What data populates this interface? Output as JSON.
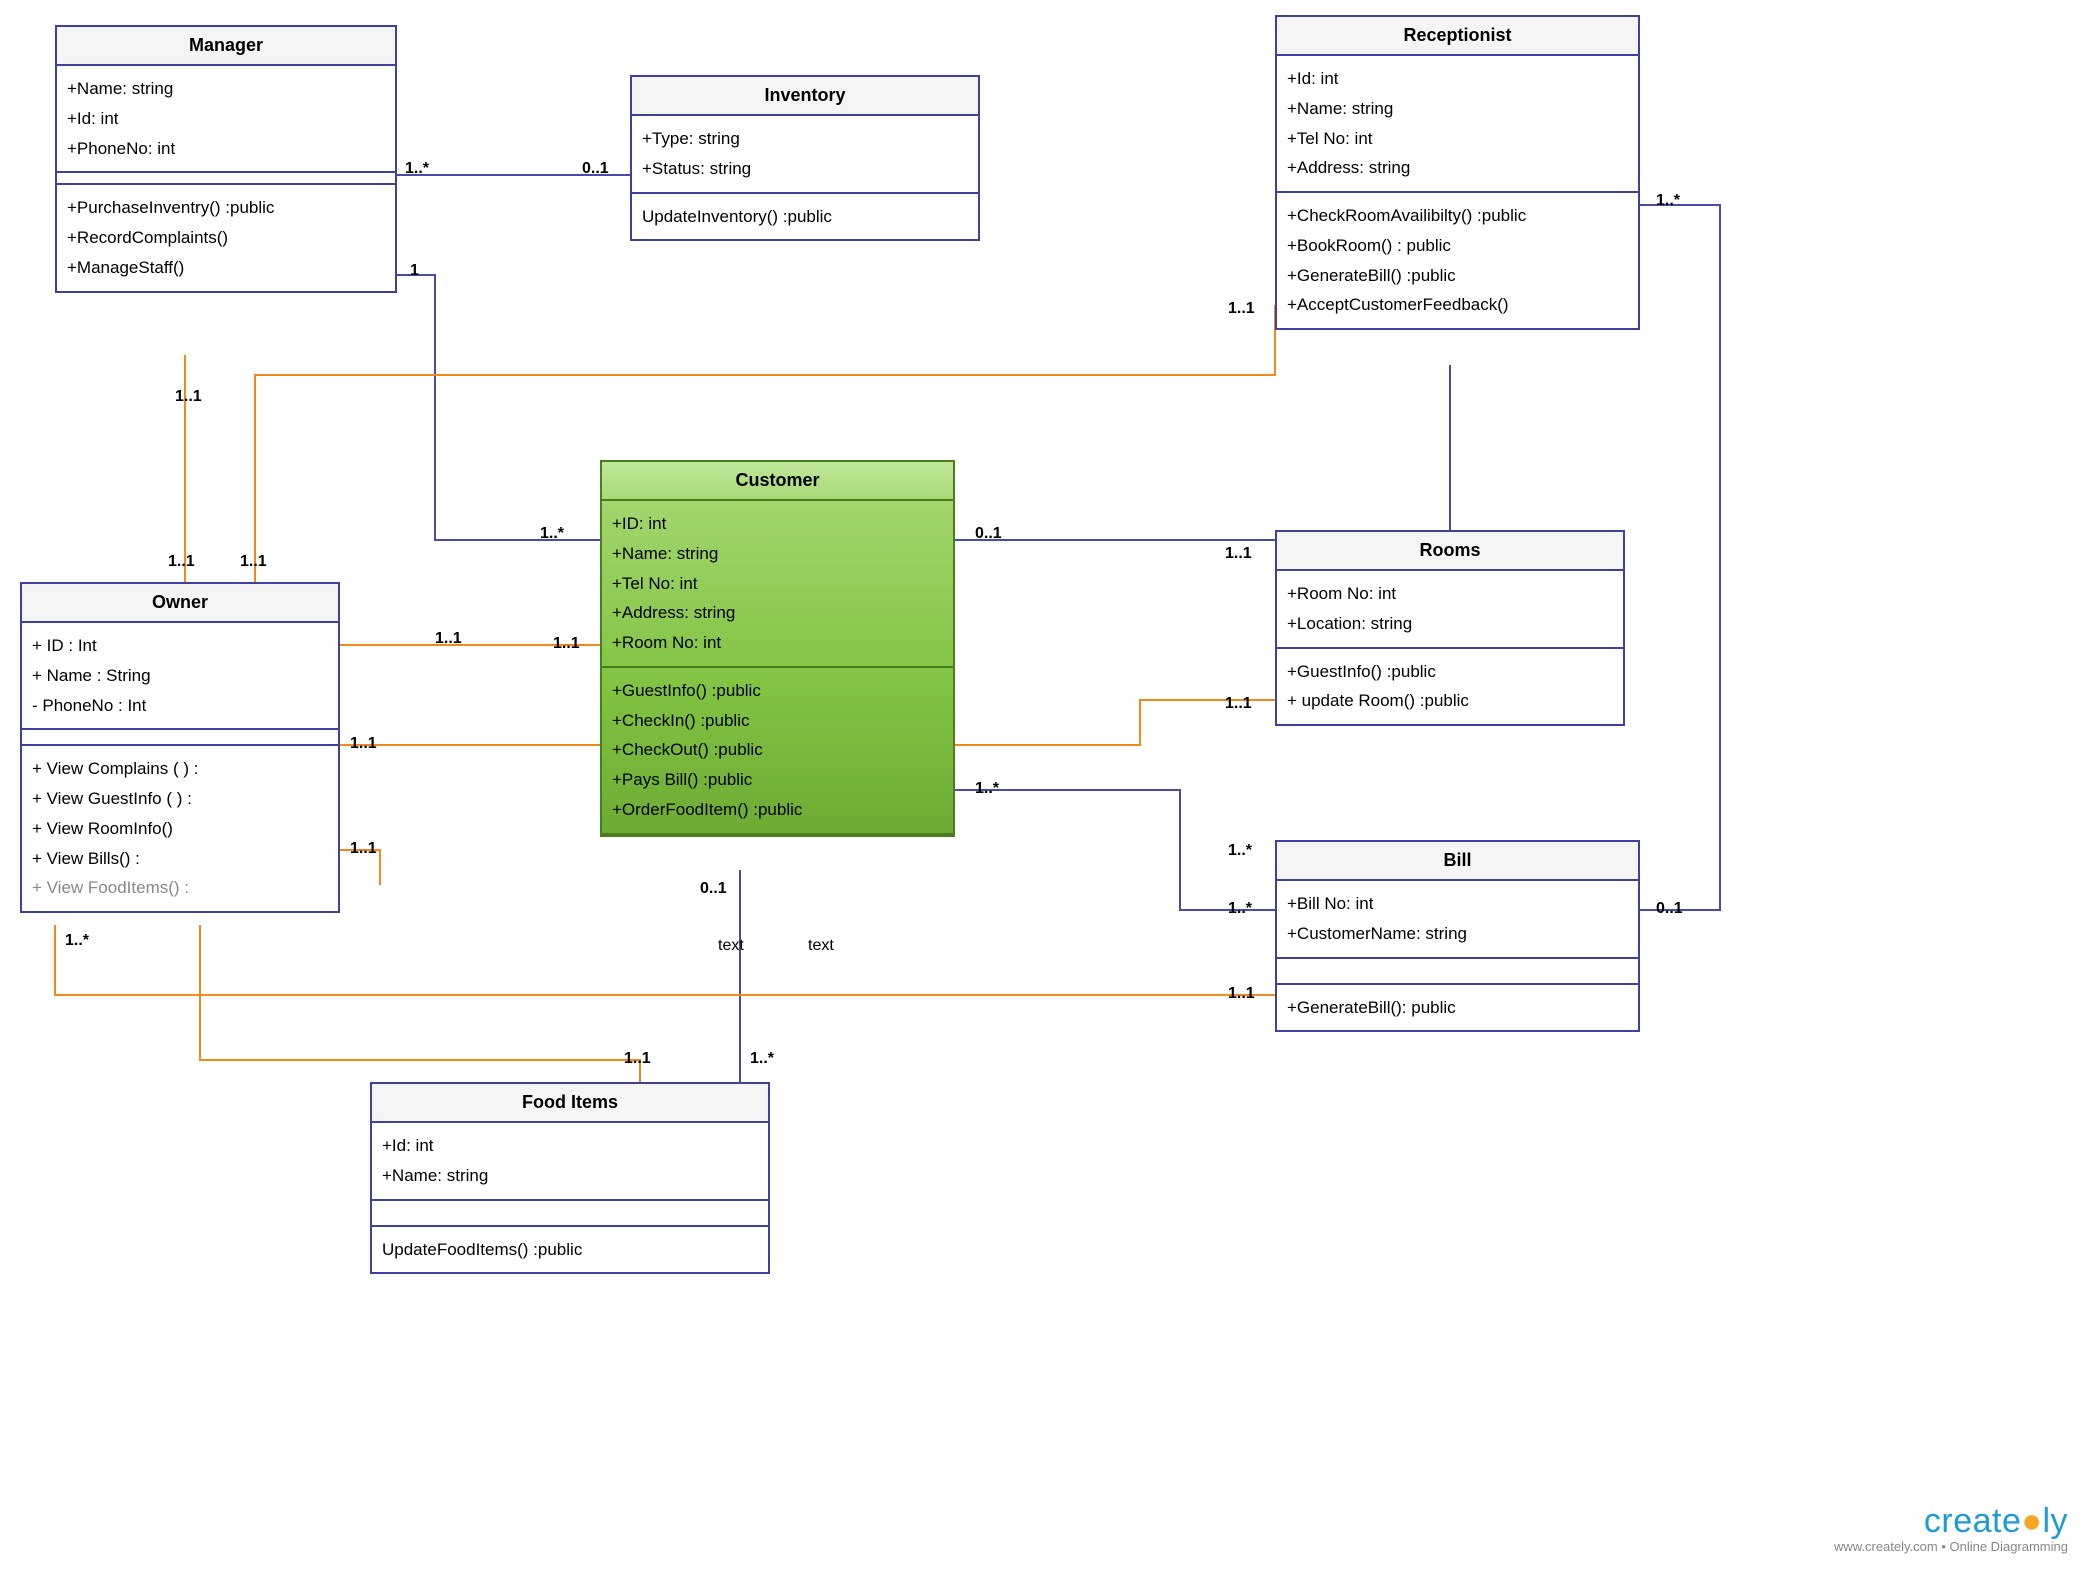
{
  "classes": {
    "manager": {
      "title": "Manager",
      "attrs": [
        "+Name: string",
        "+Id: int",
        "+PhoneNo: int"
      ],
      "ops": [
        "+PurchaseInventry() :public",
        "+RecordComplaints()",
        "+ManageStaff()"
      ]
    },
    "inventory": {
      "title": "Inventory",
      "attrs": [
        "+Type: string",
        "+Status: string"
      ],
      "ops": [
        "UpdateInventory() :public"
      ]
    },
    "receptionist": {
      "title": "Receptionist",
      "attrs": [
        "+Id: int",
        "+Name: string",
        "+Tel No: int",
        "+Address: string"
      ],
      "ops": [
        "+CheckRoomAvailibilty() :public",
        "+BookRoom() : public",
        "+GenerateBill() :public",
        "+AcceptCustomerFeedback()"
      ]
    },
    "customer": {
      "title": "Customer",
      "attrs": [
        "+ID: int",
        "+Name: string",
        "+Tel No: int",
        "+Address: string",
        "+Room No: int"
      ],
      "ops": [
        "+GuestInfo() :public",
        "+CheckIn() :public",
        "+CheckOut() :public",
        "+Pays Bill()  :public",
        "+OrderFoodItem() :public"
      ]
    },
    "owner": {
      "title": "Owner",
      "attrs": [
        "+ ID : Int",
        "+ Name : String",
        "- PhoneNo : Int"
      ],
      "ops": [
        "+ View Complains ( ) :",
        "+ View GuestInfo ( ) :",
        "+ View RoomInfo()",
        "+ View Bills() :",
        "+ View FoodItems() :"
      ]
    },
    "rooms": {
      "title": "Rooms",
      "attrs": [
        "+Room No: int",
        "+Location: string"
      ],
      "ops": [
        "+GuestInfo() :public",
        "+ update Room() :public"
      ]
    },
    "bill": {
      "title": "Bill",
      "attrs": [
        "+Bill No: int",
        "+CustomerName: string"
      ],
      "ops": [
        "+GenerateBill(): public"
      ]
    },
    "food": {
      "title": "Food Items",
      "attrs": [
        "+Id: int",
        "+Name: string"
      ],
      "ops": [
        "UpdateFoodItems() :public"
      ]
    }
  },
  "mult": {
    "m1": "1..*",
    "m2": "0..1",
    "m3": "1",
    "m4": "1..1",
    "m5": "1..*",
    "m6": "1..1",
    "m7": "1..1",
    "m8": "1..1",
    "m9": "1..*",
    "m10": "1..1",
    "m11": "1..1",
    "m12": "0..1",
    "m13": "1..1",
    "m14": "1..*",
    "m15": "1..1",
    "m16": "1..*",
    "m17": "1..*",
    "m18": "1..*",
    "m19": "0..1",
    "m20": "0..1",
    "m21": "1..1",
    "m22": "1..1",
    "m23": "1..1",
    "m24": "1..*",
    "m25": "1..1"
  },
  "edgetext": {
    "t1": "text",
    "t2": "text"
  },
  "footer": {
    "brand_a": "create",
    "brand_b": "ly",
    "tagline": "www.creately.com • Online Diagramming"
  }
}
